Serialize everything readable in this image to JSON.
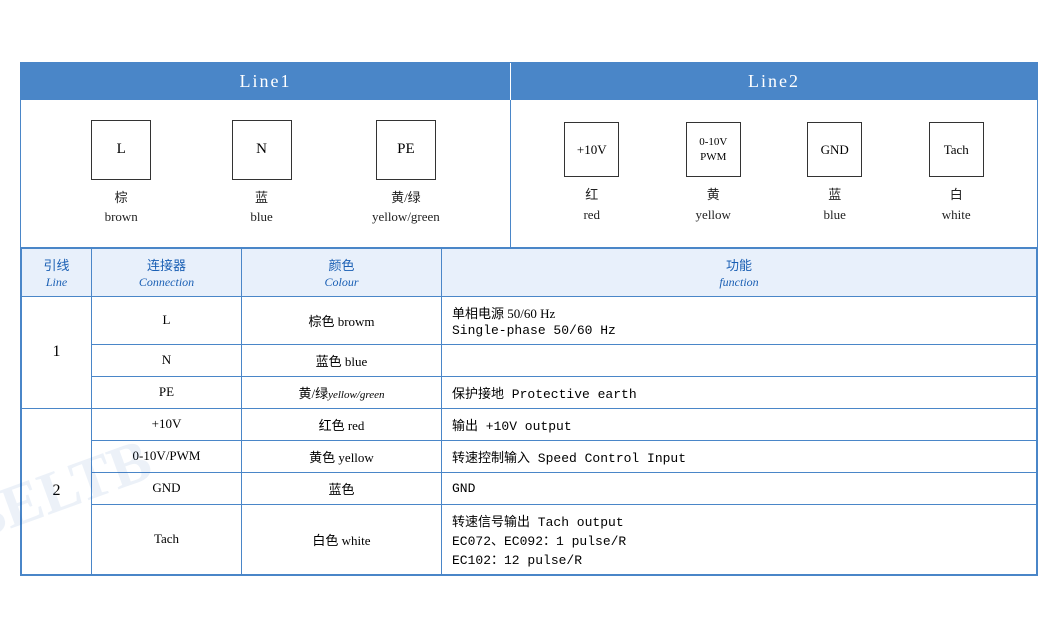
{
  "header": {
    "line1_label": "Line1",
    "line2_label": "Line2"
  },
  "line1_connectors": [
    {
      "symbol": "L",
      "chinese": "棕",
      "english": "brown"
    },
    {
      "symbol": "N",
      "chinese": "蓝",
      "english": "blue"
    },
    {
      "symbol": "PE",
      "chinese": "黄/绿",
      "english": "yellow/green"
    }
  ],
  "line2_connectors": [
    {
      "symbol": "+10V",
      "chinese": "红",
      "english": "red"
    },
    {
      "symbol": "0-10V\nPWM",
      "chinese": "黄",
      "english": "yellow"
    },
    {
      "symbol": "GND",
      "chinese": "蓝",
      "english": "blue"
    },
    {
      "symbol": "Tach",
      "chinese": "白",
      "english": "white"
    }
  ],
  "table": {
    "headers": {
      "line_zh": "引线",
      "line_en": "Line",
      "connection_zh": "连接器",
      "connection_en": "Connection",
      "colour_zh": "颜色",
      "colour_en": "Colour",
      "function_zh": "功能",
      "function_en": "function"
    },
    "rows": [
      {
        "line_num": "1",
        "entries": [
          {
            "connection": "L",
            "colour_zh": "棕色",
            "colour_en": "browm",
            "function": "单相电源 50/60 Hz\nSingle-phase 50/60 Hz",
            "rowspan": 1
          },
          {
            "connection": "N",
            "colour_zh": "蓝色",
            "colour_en": "blue",
            "function": "",
            "rowspan": 1
          },
          {
            "connection": "PE",
            "colour_zh": "黄/绿",
            "colour_en": "yellow/green",
            "colour_small": true,
            "function": "保护接地 Protective earth",
            "rowspan": 1
          }
        ]
      },
      {
        "line_num": "2",
        "entries": [
          {
            "connection": "+10V",
            "colour_zh": "红色",
            "colour_en": "red",
            "function": "输出 +10V output"
          },
          {
            "connection": "0-10V/PWM",
            "colour_zh": "黄色",
            "colour_en": "yellow",
            "function": "转速控制输入 Speed Control Input"
          },
          {
            "connection": "GND",
            "colour_zh": "蓝色",
            "colour_en": "",
            "function": "GND"
          },
          {
            "connection": "Tach",
            "colour_zh": "白色",
            "colour_en": "white",
            "function": "转速信号输出 Tach output\nEC072、EC092：1 pulse/R\nEC102：12 pulse/R"
          }
        ]
      }
    ]
  },
  "watermark": "BELTB"
}
